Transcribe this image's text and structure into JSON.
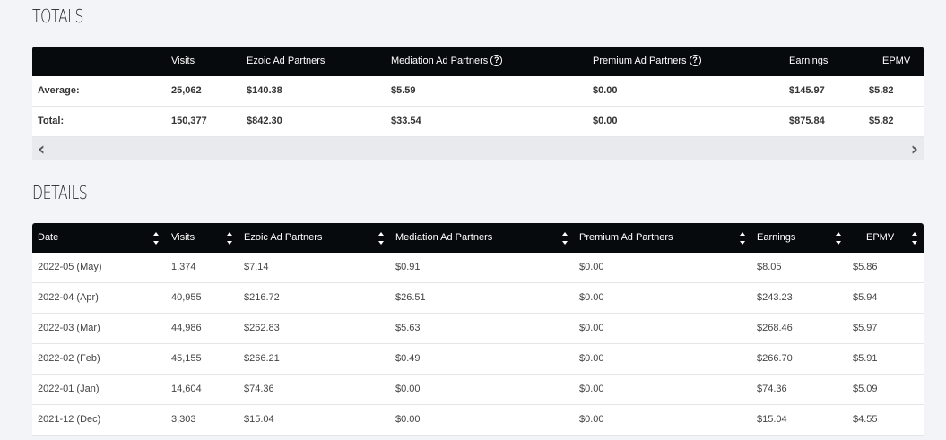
{
  "totals": {
    "title": "TOTALS",
    "headers": [
      "",
      "Visits",
      "Ezoic Ad Partners",
      "Mediation Ad Partners",
      "Premium Ad Partners",
      "Earnings",
      "EPMV"
    ],
    "rows": [
      [
        "Average:",
        "25,062",
        "$140.38",
        "$5.59",
        "$0.00",
        "$145.97",
        "$5.82"
      ],
      [
        "Total:",
        "150,377",
        "$842.30",
        "$33.54",
        "$0.00",
        "$875.84",
        "$5.82"
      ]
    ],
    "scroll_left": "‹",
    "scroll_right": "›"
  },
  "details": {
    "title": "DETAILS",
    "headers": [
      "Date",
      "Visits",
      "Ezoic Ad Partners",
      "Mediation Ad Partners",
      "Premium Ad Partners",
      "Earnings",
      "EPMV"
    ],
    "rows": [
      [
        "2022-05 (May)",
        "1,374",
        "$7.14",
        "$0.91",
        "$0.00",
        "$8.05",
        "$5.86"
      ],
      [
        "2022-04 (Apr)",
        "40,955",
        "$216.72",
        "$26.51",
        "$0.00",
        "$243.23",
        "$5.94"
      ],
      [
        "2022-03 (Mar)",
        "44,986",
        "$262.83",
        "$5.63",
        "$0.00",
        "$268.46",
        "$5.97"
      ],
      [
        "2022-02 (Feb)",
        "45,155",
        "$266.21",
        "$0.49",
        "$0.00",
        "$266.70",
        "$5.91"
      ],
      [
        "2022-01 (Jan)",
        "14,604",
        "$74.36",
        "$0.00",
        "$0.00",
        "$74.36",
        "$5.09"
      ],
      [
        "2021-12 (Dec)",
        "3,303",
        "$15.04",
        "$0.00",
        "$0.00",
        "$15.04",
        "$4.55"
      ]
    ]
  }
}
